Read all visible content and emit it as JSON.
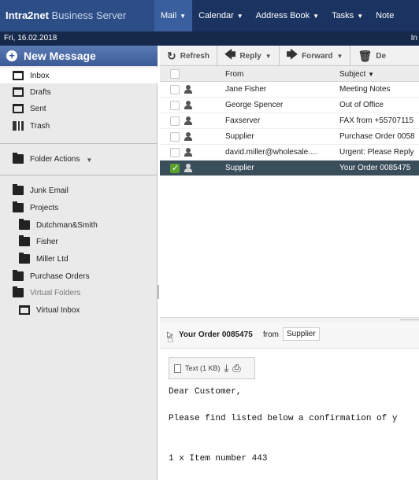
{
  "app": {
    "brand_bold": "Intra2net",
    "brand_light": "Business Server",
    "date": "Fri, 16.02.2018",
    "subbar_right": "In"
  },
  "menu": {
    "items": [
      {
        "label": "Mail"
      },
      {
        "label": "Calendar"
      },
      {
        "label": "Address Book"
      },
      {
        "label": "Tasks"
      },
      {
        "label": "Note"
      }
    ]
  },
  "sidebar": {
    "new_message": "New Message",
    "folders": {
      "inbox": "Inbox",
      "drafts": "Drafts",
      "sent": "Sent",
      "trash": "Trash",
      "folder_actions": "Folder Actions",
      "junk": "Junk Email",
      "projects": "Projects",
      "dutchman": "Dutchman&Smith",
      "fisher": "Fisher",
      "miller": "Miller Ltd",
      "purchase_orders": "Purchase Orders",
      "virtual_folders": "Virtual Folders",
      "virtual_inbox": "Virtual Inbox"
    }
  },
  "toolbar": {
    "refresh": "Refresh",
    "reply": "Reply",
    "forward": "Forward",
    "delete": "De"
  },
  "list": {
    "col_from": "From",
    "col_subject": "Subject",
    "rows": [
      {
        "from": "Jane Fisher",
        "subject": "Meeting Notes"
      },
      {
        "from": "George Spencer",
        "subject": "Out of Office"
      },
      {
        "from": "Faxserver",
        "subject": "FAX from +55707115"
      },
      {
        "from": "Supplier",
        "subject": "Purchase Order 0058"
      },
      {
        "from": "david.miller@wholesale.…",
        "subject": "Urgent: Please Reply"
      },
      {
        "from": "Supplier",
        "subject": "Your Order 0085475"
      }
    ]
  },
  "preview": {
    "subject": "Your Order 0085475",
    "from_label": "from",
    "sender": "Supplier",
    "attachment": "Text (1 KB)",
    "body": "Dear Customer,\n\nPlease find listed below a confirmation of y\n\n\n1 x Item number 443"
  }
}
